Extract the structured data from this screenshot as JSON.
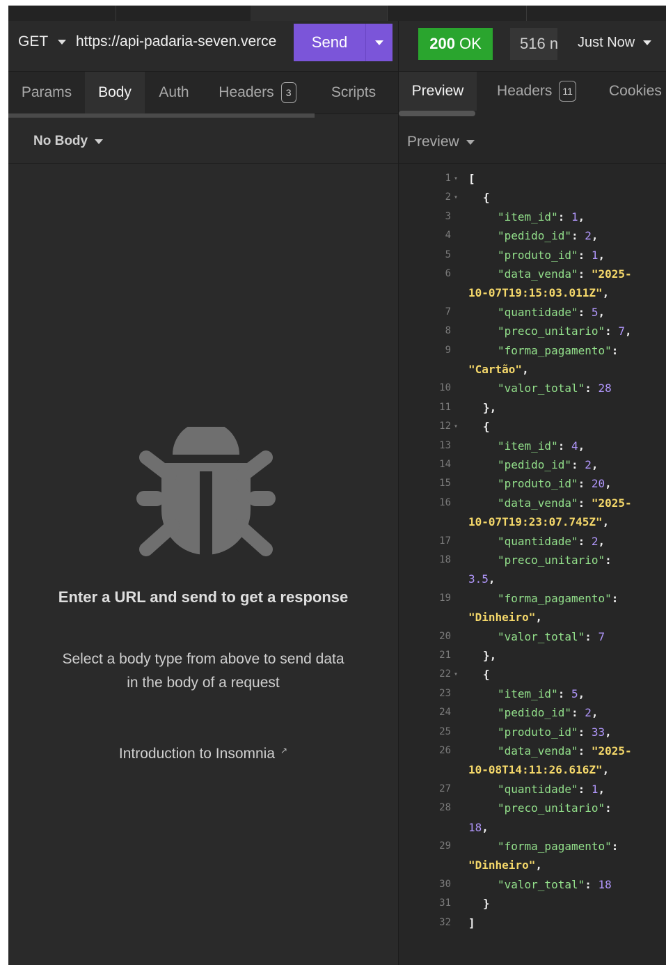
{
  "request": {
    "method": "GET",
    "url": "https://api-padaria-seven.verce",
    "send_label": "Send"
  },
  "request_tabs": [
    {
      "label": "Params"
    },
    {
      "label": "Body"
    },
    {
      "label": "Auth"
    },
    {
      "label": "Headers",
      "badge": "3"
    },
    {
      "label": "Scripts"
    }
  ],
  "body_selector": "No Body",
  "empty_state": {
    "title": "Enter a URL and send to get a response",
    "subtitle_line1": "Select a body type from above to send data",
    "subtitle_line2": "in the body of a request",
    "link": "Introduction to Insomnia"
  },
  "response": {
    "status_code": "200",
    "status_text": "OK",
    "size": "516 n",
    "time": "Just Now",
    "tabs": [
      {
        "label": "Preview"
      },
      {
        "label": "Headers",
        "badge": "11"
      },
      {
        "label": "Cookies"
      }
    ],
    "preview_mode": "Preview"
  },
  "code_lines": [
    {
      "n": "1",
      "fold": true,
      "indent": 0,
      "text": "["
    },
    {
      "n": "2",
      "fold": true,
      "indent": 1,
      "text": "{"
    },
    {
      "n": "3",
      "indent": 2,
      "key": "\"item_id\"",
      "num": "1",
      "comma": true
    },
    {
      "n": "4",
      "indent": 2,
      "key": "\"pedido_id\"",
      "num": "2",
      "comma": true
    },
    {
      "n": "5",
      "indent": 2,
      "key": "\"produto_id\"",
      "num": "1",
      "comma": true
    },
    {
      "n": "6",
      "indent": 2,
      "key": "\"data_venda\"",
      "str": "\"2025-"
    },
    {
      "n": "",
      "indent": 0,
      "str": "10-07T19:15:03.011Z\"",
      "comma": true
    },
    {
      "n": "7",
      "indent": 2,
      "key": "\"quantidade\"",
      "num": "5",
      "comma": true
    },
    {
      "n": "8",
      "indent": 2,
      "key": "\"preco_unitario\"",
      "num": "7",
      "comma": true
    },
    {
      "n": "9",
      "indent": 2,
      "key": "\"forma_pagamento\"",
      "colon_only": true
    },
    {
      "n": "",
      "indent": 0,
      "str": "\"Cartão\"",
      "comma": true
    },
    {
      "n": "10",
      "indent": 2,
      "key": "\"valor_total\"",
      "num": "28"
    },
    {
      "n": "11",
      "indent": 1,
      "text": "},"
    },
    {
      "n": "12",
      "fold": true,
      "indent": 1,
      "text": "{"
    },
    {
      "n": "13",
      "indent": 2,
      "key": "\"item_id\"",
      "num": "4",
      "comma": true
    },
    {
      "n": "14",
      "indent": 2,
      "key": "\"pedido_id\"",
      "num": "2",
      "comma": true
    },
    {
      "n": "15",
      "indent": 2,
      "key": "\"produto_id\"",
      "num": "20",
      "comma": true
    },
    {
      "n": "16",
      "indent": 2,
      "key": "\"data_venda\"",
      "str": "\"2025-"
    },
    {
      "n": "",
      "indent": 0,
      "str": "10-07T19:23:07.745Z\"",
      "comma": true
    },
    {
      "n": "17",
      "indent": 2,
      "key": "\"quantidade\"",
      "num": "2",
      "comma": true
    },
    {
      "n": "18",
      "indent": 2,
      "key": "\"preco_unitario\"",
      "colon_only": true
    },
    {
      "n": "",
      "indent": 0,
      "num": "3.5",
      "comma": true
    },
    {
      "n": "19",
      "indent": 2,
      "key": "\"forma_pagamento\"",
      "colon_only": true
    },
    {
      "n": "",
      "indent": 0,
      "str": "\"Dinheiro\"",
      "comma": true
    },
    {
      "n": "20",
      "indent": 2,
      "key": "\"valor_total\"",
      "num": "7"
    },
    {
      "n": "21",
      "indent": 1,
      "text": "},"
    },
    {
      "n": "22",
      "fold": true,
      "indent": 1,
      "text": "{"
    },
    {
      "n": "23",
      "indent": 2,
      "key": "\"item_id\"",
      "num": "5",
      "comma": true
    },
    {
      "n": "24",
      "indent": 2,
      "key": "\"pedido_id\"",
      "num": "2",
      "comma": true
    },
    {
      "n": "25",
      "indent": 2,
      "key": "\"produto_id\"",
      "num": "33",
      "comma": true
    },
    {
      "n": "26",
      "indent": 2,
      "key": "\"data_venda\"",
      "str": "\"2025-"
    },
    {
      "n": "",
      "indent": 0,
      "str": "10-08T14:11:26.616Z\"",
      "comma": true
    },
    {
      "n": "27",
      "indent": 2,
      "key": "\"quantidade\"",
      "num": "1",
      "comma": true
    },
    {
      "n": "28",
      "indent": 2,
      "key": "\"preco_unitario\"",
      "colon_only": true
    },
    {
      "n": "",
      "indent": 0,
      "num": "18",
      "comma": true
    },
    {
      "n": "29",
      "indent": 2,
      "key": "\"forma_pagamento\"",
      "colon_only": true
    },
    {
      "n": "",
      "indent": 0,
      "str": "\"Dinheiro\"",
      "comma": true
    },
    {
      "n": "30",
      "indent": 2,
      "key": "\"valor_total\"",
      "num": "18"
    },
    {
      "n": "31",
      "indent": 1,
      "text": "}"
    },
    {
      "n": "32",
      "indent": 0,
      "text": "]"
    }
  ],
  "colors": {
    "send_button": "#7b55d9",
    "status_ok": "#2aa52e",
    "json_key": "#93e08b",
    "json_number": "#b197fc",
    "json_string": "#f5d86a"
  }
}
